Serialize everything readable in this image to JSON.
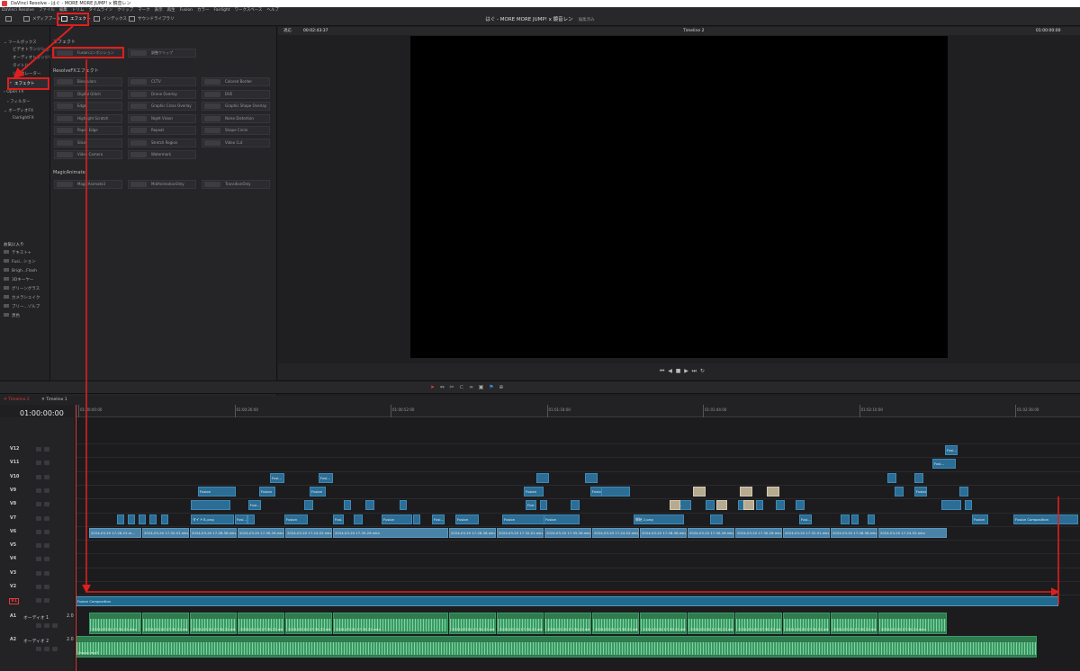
{
  "window": {
    "title": "DaVinci Resolve - はぐ - MORE MORE JUMP! x 鏡音レン"
  },
  "menubar": {
    "items": [
      "DaVinci Resolve",
      "ファイル",
      "編集",
      "トリム",
      "タイムライン",
      "クリップ",
      "マーク",
      "表示",
      "再生",
      "Fusion",
      "カラー",
      "Fairlight",
      "ワークスペース",
      "ヘルプ"
    ]
  },
  "toolbar": {
    "media_pool": "メディアプール",
    "effects": "エフェクト",
    "index": "インデックス",
    "sound_library": "サウンドライブラリ"
  },
  "project": {
    "title": "はぐ - MORE MORE JUMP! x 鏡音レン",
    "status": "編集済み"
  },
  "left_tree": {
    "toolbox": "ツールボックス",
    "video_transitions": "ビデオトランジション",
    "audio_transitions": "オーディオトランジション",
    "titles": "タイトル",
    "generators": "ジェネレーター",
    "effects": "エフェクト",
    "openfx": "Open FX",
    "filters": "フィルター",
    "audiofx": "オーディオFX",
    "fairlightfx": "FairlightFX",
    "favorites": "お気に入り",
    "fav_items": [
      "テキスト+",
      "Fusi...ション",
      "Brigh...Flash",
      "3Dキーヤー",
      "グリーングラス",
      "カメラシェイク",
      "ブリー...ゾルブ",
      "黒色"
    ]
  },
  "effects_panel": {
    "section_effects": "エフェクト",
    "fusion_composition": "Fusionコンポジション",
    "adjustment_clip": "調整クリップ",
    "section_resolvefx": "ResolveFXエフェクト",
    "resolvefx": [
      "Binoculars",
      "CCTV",
      "Colored Border",
      "Digital Glitch",
      "Drone Overlay",
      "DVE",
      "Edge",
      "Graphic Cross Overlay",
      "Graphic Shape Overlay",
      "Highlight Scratch",
      "Night Vision",
      "Noise Distortion",
      "Paper Edge",
      "Repeat",
      "Shape Circle",
      "Slice",
      "Stretch Region",
      "Video Cut",
      "Video Camera",
      "Watermark"
    ],
    "section_magic": "MagicAnimate",
    "magic": [
      "MagicAnimate3",
      "MidAnimationOnly",
      "TransitionOnly"
    ]
  },
  "viewer": {
    "zoom": "適応",
    "source_timecode": "00:02:43:37",
    "timeline_name": "Timeline 2",
    "record_timecode": "01:00:00:00"
  },
  "timeline": {
    "tabs": [
      "Timeline 2",
      "Timeline 1"
    ],
    "timecode": "01:00:00:00",
    "ruler": [
      "01:00:00:00",
      "01:00:26:00",
      "01:00:52:00",
      "01:01:18:00",
      "01:01:44:00",
      "01:02:10:00",
      "01:02:36:00"
    ],
    "video_tracks": [
      "V12",
      "V11",
      "V10",
      "V9",
      "V8",
      "V7",
      "V6",
      "V5",
      "V4",
      "V3",
      "V2",
      "V1"
    ],
    "audio_tracks": [
      {
        "id": "A1",
        "name": "オーディオ 1",
        "level": "2.0"
      },
      {
        "id": "A2",
        "name": "オーディオ 2",
        "level": "2.0"
      }
    ],
    "v1_clip": "Fusion Composition",
    "a2_clip": "(hagu).mp3",
    "v6_clips": [
      "2024-03-20 17-26-22.m...",
      "2024-03-20 17-32-01.mkv",
      "2024-03-20 17-28-38.mkv",
      "2024-03-20 17-30-26.mkv",
      "2024-03-20 17-24-52.mkv",
      "2024-03-20 17-35-26.mkv",
      "2024-03-20 17-28-38.mkv",
      "2024-03-20 17-32-01.mkv",
      "2024-03-20 17-35-26.mkv",
      "2024-03-20 17-24-52.mkv",
      "2024-03-20 17-28-38.mkv",
      "2024-03-20 17-30-26.mkv",
      "2024-03-20 17-30-26.mkv",
      "2024-03-20 17-32-01.mkv",
      "2024-03-20 17-28-38.mkv",
      "2024-03-20 17-24-52.mkv"
    ],
    "v7_label_a": "タイトル.png",
    "v7_label_b": "開始 2.png",
    "v7_last": "Fusion Composition",
    "fusion_short": "Fusion",
    "fusi_short": "Fusi...",
    "audio_clip_name": "2024-03-20 17-30-22.mkv"
  },
  "colors": {
    "accent_red": "#e01e1e",
    "clip_blue": "#2c6d95",
    "audio_green": "#2f7a4f",
    "title_tan": "#b6ab90"
  }
}
